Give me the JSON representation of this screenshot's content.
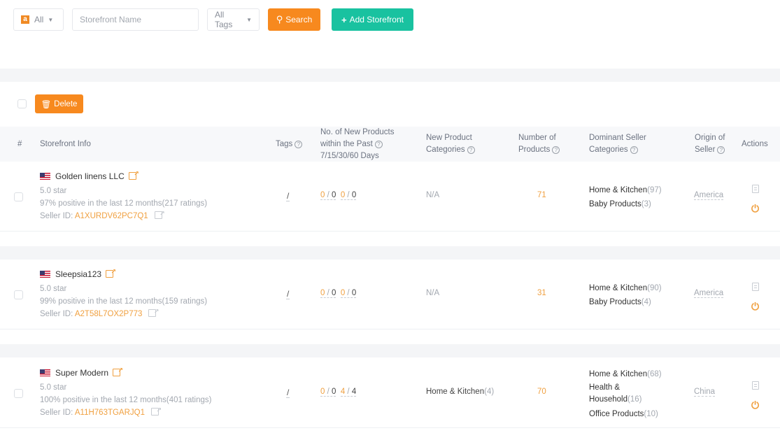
{
  "toolbar": {
    "marketplace_select": {
      "icon": "amazon-icon",
      "icon_glyph": "a",
      "value": "All"
    },
    "storefront_name_placeholder": "Storefront Name",
    "storefront_name_value": "",
    "tags_select": {
      "value": "All Tags"
    },
    "search_label": "Search",
    "add_storefront_label": "Add Storefront"
  },
  "bulk": {
    "delete_label": "Delete"
  },
  "table": {
    "headers": {
      "index": "#",
      "storefront_info": "Storefront Info",
      "tags": "Tags",
      "new_products_l1": "No. of New Products",
      "new_products_l2": "within the Past",
      "new_products_l3": "7/15/30/60 Days",
      "new_categories_l1": "New Product",
      "new_categories_l2": "Categories",
      "num_products_l1": "Number of",
      "num_products_l2": "Products",
      "dominant_l1": "Dominant Seller",
      "dominant_l2": "Categories",
      "origin_l1": "Origin of",
      "origin_l2": "Seller",
      "actions": "Actions"
    },
    "rows": [
      {
        "name": "Golden linens LLC",
        "country_flag": "us-flag",
        "stars": "5.0 star",
        "feedback": "97% positive  in the last 12 months(217 ratings)",
        "seller_id_label": "Seller ID: ",
        "seller_id": "A1XURDV62PC7Q1",
        "new_7": "0",
        "new_15": "0",
        "new_30": "0",
        "new_60": "0",
        "new_categories": "N/A",
        "new_categories_count": "",
        "num_products": "71",
        "dominant": [
          {
            "name": "Home & Kitchen",
            "count": "(97)"
          },
          {
            "name": "Baby Products",
            "count": "(3)"
          }
        ],
        "origin": "America"
      },
      {
        "name": "Sleepsia123",
        "country_flag": "us-flag",
        "stars": "5.0 star",
        "feedback": "99% positive  in the last 12 months(159 ratings)",
        "seller_id_label": "Seller ID: ",
        "seller_id": "A2T58L7OX2P773",
        "new_7": "0",
        "new_15": "0",
        "new_30": "0",
        "new_60": "0",
        "new_categories": "N/A",
        "new_categories_count": "",
        "num_products": "31",
        "dominant": [
          {
            "name": "Home & Kitchen",
            "count": "(90)"
          },
          {
            "name": "Baby Products",
            "count": "(4)"
          }
        ],
        "origin": "America"
      },
      {
        "name": "Super Modern",
        "country_flag": "us-flag",
        "stars": "5.0 star",
        "feedback": "100% positive  in the last 12 months(401 ratings)",
        "seller_id_label": "Seller ID: ",
        "seller_id": "A11H763TGARJQ1",
        "new_7": "0",
        "new_15": "0",
        "new_30": "4",
        "new_60": "4",
        "new_categories": "Home & Kitchen",
        "new_categories_count": "(4)",
        "num_products": "70",
        "dominant": [
          {
            "name": "Home & Kitchen",
            "count": "(68)"
          },
          {
            "name": "Health & Household",
            "count": "(16)"
          },
          {
            "name": "Office Products",
            "count": "(10)"
          }
        ],
        "origin": "China"
      }
    ],
    "slash": "/"
  },
  "colors": {
    "primary_orange": "#f7891e",
    "accent_teal": "#19c2a0",
    "muted_text": "#a3a8b0"
  }
}
